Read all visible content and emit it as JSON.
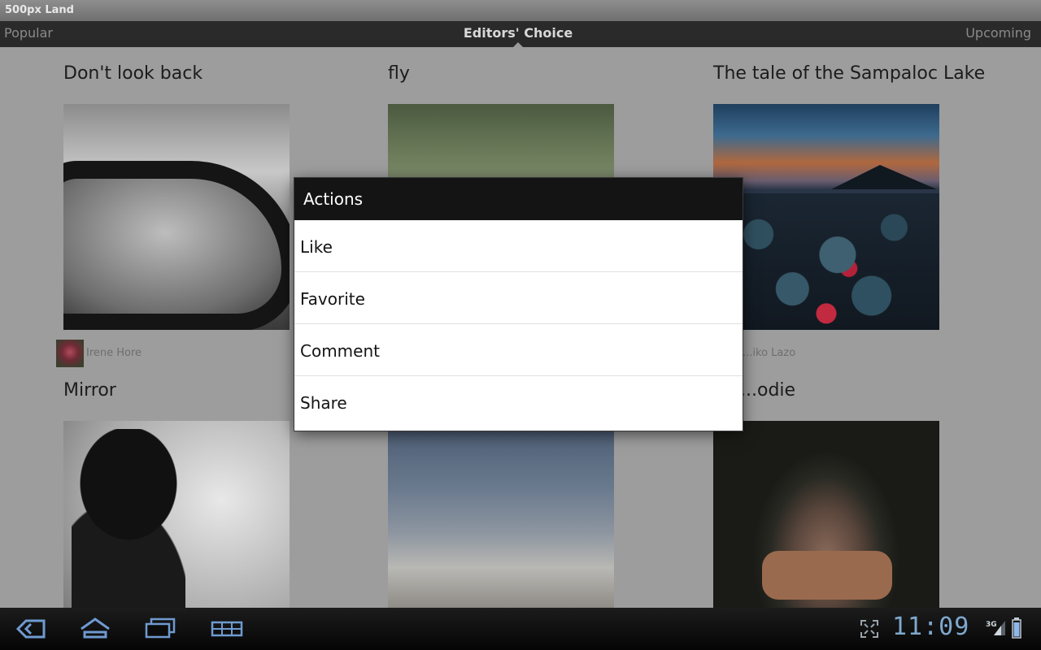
{
  "app": {
    "title": "500px Land"
  },
  "tabs": {
    "left": "Popular",
    "center": "Editors' Choice",
    "right": "Upcoming"
  },
  "photos": [
    {
      "title": "Don't look back",
      "author": "Irene Hore"
    },
    {
      "title": "fly",
      "author": ""
    },
    {
      "title": "The tale of the Sampaloc Lake",
      "author": "...iko Lazo"
    },
    {
      "title": "Mirror",
      "author": ""
    },
    {
      "title": "",
      "author": ""
    },
    {
      "title": "...odie",
      "author": ""
    }
  ],
  "dialog": {
    "title": "Actions",
    "items": [
      "Like",
      "Favorite",
      "Comment",
      "Share"
    ]
  },
  "system_bar": {
    "clock": "11:09",
    "network": "3G",
    "icons": [
      "back-icon",
      "home-icon",
      "recent-apps-icon",
      "menu-icon",
      "screen-compat-icon",
      "signal-icon",
      "battery-icon"
    ]
  }
}
